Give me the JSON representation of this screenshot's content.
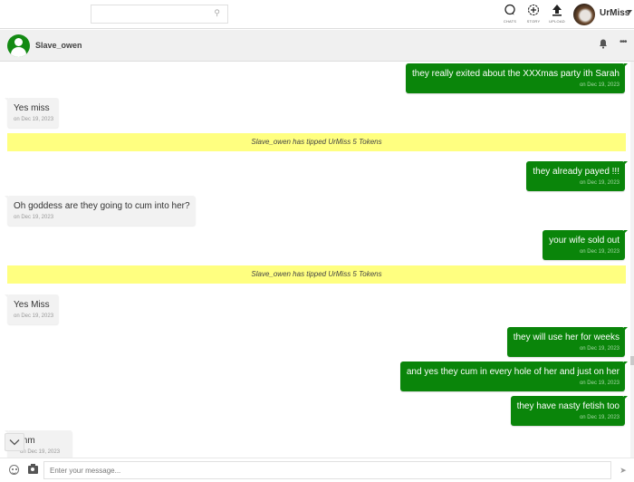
{
  "topbar": {
    "search": {
      "placeholder": "",
      "icon": "search-icon"
    },
    "nav": [
      {
        "label": "CHATS",
        "icon": "chat-bubble-icon"
      },
      {
        "label": "STORY",
        "icon": "add-story-icon"
      },
      {
        "label": "UPLOAD",
        "icon": "upload-icon"
      }
    ],
    "user": {
      "name": "UrMiss",
      "icon": "caret-down-icon"
    }
  },
  "chat_header": {
    "contact_name": "Slave_owen",
    "icons": [
      "bell-icon",
      "more-icon"
    ]
  },
  "messages": [
    {
      "type": "out",
      "text": "they really exited about the XXXmas party ith Sarah",
      "time": "on Dec 19, 2023"
    },
    {
      "type": "in",
      "text": "Yes miss",
      "time": "on Dec 19, 2023"
    },
    {
      "type": "tip",
      "text": "Slave_owen has tipped UrMiss 5 Tokens"
    },
    {
      "type": "out",
      "text": "they already payed !!!",
      "time": "on Dec 19, 2023"
    },
    {
      "type": "in",
      "text": "Oh goddess are they going to cum into her?",
      "time": "on Dec 19, 2023"
    },
    {
      "type": "out",
      "text": "your wife sold out",
      "time": "on Dec 19, 2023"
    },
    {
      "type": "tip",
      "text": "Slave_owen has tipped UrMiss 5 Tokens"
    },
    {
      "type": "in",
      "text": "Yes Miss",
      "time": "on Dec 19, 2023"
    },
    {
      "type": "out",
      "text": "they will use her for weeks",
      "time": "on Dec 19, 2023"
    },
    {
      "type": "out",
      "text": "and yes they cum in every hole of her and just on her",
      "time": "on Dec 19, 2023"
    },
    {
      "type": "out",
      "text": "they have nasty fetish too",
      "time": "on Dec 19, 2023"
    },
    {
      "type": "in",
      "text": "mm",
      "time": "on Dec 19, 2023"
    }
  ],
  "composer": {
    "placeholder": "Enter your message...",
    "value": "",
    "send_icon": "send-icon"
  },
  "colors": {
    "outgoing_bubble": "#0a850a",
    "incoming_bubble": "#f2f2f2",
    "tip_banner": "#ffff80"
  }
}
